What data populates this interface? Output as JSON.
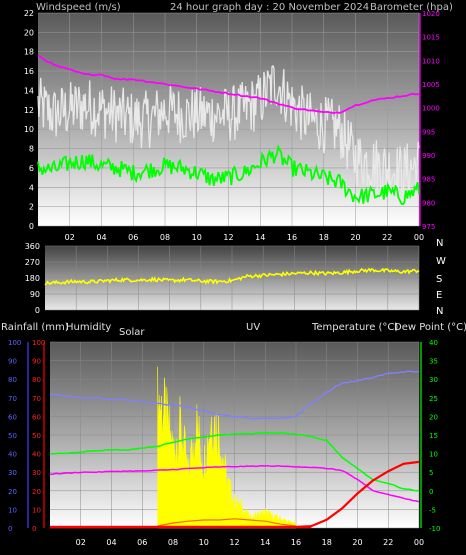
{
  "header": {
    "left": "Windspeed (m/s)",
    "center": "24 hour graph day : 20 November 2024",
    "right": "Barometer (hpa)"
  },
  "middle_labels": {
    "rainfall": "Rainfall (mm)",
    "humidity": "Humidity",
    "solar": "Solar",
    "uv": "UV",
    "temperature": "Temperature (°C)",
    "dewpoint": "Dew Point (°C)"
  },
  "colors": {
    "wind_gust": "#e8e8e8",
    "wind_avg": "#00ff00",
    "barometer": "#ff00ff",
    "direction": "#ffff00",
    "humidity": "#8080ff",
    "temperature": "#00ff00",
    "dewpoint": "#ff00ff",
    "rain": "#ff0000",
    "solar": "#ffff00",
    "uv": "#ff6600"
  },
  "chart_data": [
    {
      "type": "line",
      "name": "wind_and_barometer",
      "x_ticks": [
        "02",
        "04",
        "06",
        "08",
        "10",
        "12",
        "14",
        "16",
        "18",
        "20",
        "22",
        "00"
      ],
      "ylim_left": [
        0,
        22
      ],
      "y_ticks_left": [
        "0",
        "2",
        "4",
        "6",
        "8",
        "10",
        "12",
        "14",
        "16",
        "18",
        "20",
        "22"
      ],
      "ylim_right": [
        975,
        1020
      ],
      "y_ticks_right": [
        "975",
        "980",
        "985",
        "990",
        "995",
        "1000",
        "1005",
        "1010",
        "1015",
        "1020"
      ],
      "series": [
        {
          "x": [
            0,
            1,
            2,
            3,
            4,
            5,
            6,
            7,
            8,
            9,
            10,
            11,
            12,
            13,
            14,
            15,
            16,
            17,
            18,
            19,
            20,
            21,
            22,
            23,
            24
          ],
          "values": [
            12.5,
            11.5,
            12.0,
            12.5,
            12.0,
            11.5,
            11.0,
            11.0,
            12.0,
            11.5,
            11.5,
            11.5,
            11.5,
            12.0,
            13.0,
            15.0,
            12.5,
            11.0,
            10.5,
            10.0,
            7.0,
            6.5,
            6.0,
            5.5,
            6.5
          ]
        },
        {
          "x": [
            0,
            1,
            2,
            3,
            4,
            5,
            6,
            7,
            8,
            9,
            10,
            11,
            12,
            13,
            14,
            15,
            16,
            17,
            18,
            19,
            20,
            21,
            22,
            23,
            24
          ],
          "values": [
            6.0,
            5.8,
            6.5,
            6.8,
            6.2,
            6.0,
            5.5,
            5.8,
            6.2,
            6.0,
            5.5,
            4.8,
            5.0,
            5.5,
            6.5,
            7.5,
            6.0,
            5.5,
            5.0,
            4.5,
            3.0,
            3.2,
            3.5,
            3.0,
            3.8
          ]
        },
        {
          "x": [
            0,
            1,
            2,
            3,
            4,
            5,
            6,
            7,
            8,
            9,
            10,
            11,
            12,
            13,
            14,
            15,
            16,
            17,
            18,
            19,
            20,
            21,
            22,
            23,
            24
          ],
          "values": [
            1011,
            1009,
            1008,
            1007,
            1007,
            1006,
            1006,
            1005.5,
            1005,
            1004.5,
            1004,
            1003.5,
            1003,
            1002.5,
            1002,
            1001,
            1000,
            999.5,
            999,
            999,
            1000.5,
            1001.5,
            1002,
            1002.5,
            1003
          ]
        }
      ]
    },
    {
      "type": "line",
      "name": "wind_direction",
      "x_ticks": [
        "02",
        "04",
        "06",
        "08",
        "10",
        "12",
        "14",
        "16",
        "18",
        "20",
        "22",
        "00"
      ],
      "ylim": [
        0,
        360
      ],
      "y_ticks": [
        "0",
        "90",
        "180",
        "270",
        "360"
      ],
      "side_labels": [
        "N",
        "W",
        "S",
        "E",
        "N"
      ],
      "series": [
        {
          "x": [
            0,
            1,
            2,
            3,
            4,
            5,
            6,
            7,
            8,
            9,
            10,
            11,
            12,
            13,
            14,
            15,
            16,
            17,
            18,
            19,
            20,
            21,
            22,
            23,
            24
          ],
          "values": [
            150,
            155,
            160,
            158,
            165,
            170,
            168,
            172,
            165,
            170,
            162,
            160,
            165,
            190,
            195,
            200,
            205,
            210,
            205,
            210,
            220,
            225,
            220,
            215,
            222
          ]
        }
      ]
    },
    {
      "type": "line",
      "name": "humidity_temperature_rain_solar",
      "x_ticks": [
        "02",
        "04",
        "06",
        "08",
        "10",
        "12",
        "14",
        "16",
        "18",
        "20",
        "22",
        "00"
      ],
      "ylim_humidity": [
        0,
        100
      ],
      "y_ticks_humidity": [
        "0",
        "10",
        "20",
        "30",
        "40",
        "50",
        "60",
        "70",
        "80",
        "90",
        "100"
      ],
      "ylim_rain": [
        0,
        100
      ],
      "y_ticks_rain": [
        "0",
        "10",
        "20",
        "30",
        "40",
        "50",
        "60",
        "70",
        "80",
        "90",
        "100"
      ],
      "ylim_temperature": [
        -10,
        40
      ],
      "y_ticks_temperature": [
        "-10",
        "-5",
        "0",
        "5",
        "10",
        "15",
        "20",
        "25",
        "30",
        "35",
        "40"
      ],
      "series": [
        {
          "x": [
            0,
            1,
            2,
            3,
            4,
            5,
            6,
            7,
            8,
            9,
            10,
            11,
            12,
            13,
            14,
            15,
            16,
            17,
            18,
            19,
            20,
            21,
            22,
            23,
            24
          ],
          "values": [
            72,
            71,
            70,
            70,
            69,
            69,
            68,
            67,
            66,
            65,
            63,
            61,
            60,
            59,
            59,
            59,
            60,
            67,
            73,
            78,
            79,
            81,
            83,
            84,
            84
          ]
        },
        {
          "x": [
            0,
            1,
            2,
            3,
            4,
            5,
            6,
            7,
            8,
            9,
            10,
            11,
            12,
            13,
            14,
            15,
            16,
            17,
            18,
            19,
            20,
            21,
            22,
            23,
            24
          ],
          "values": [
            10.0,
            10.0,
            10.5,
            10.8,
            11.0,
            11.0,
            11.5,
            12.0,
            13.0,
            14.0,
            14.5,
            15.0,
            15.2,
            15.4,
            15.5,
            15.5,
            15.2,
            14.5,
            13.5,
            9.0,
            6.0,
            3.0,
            2.0,
            0.5,
            0.0
          ]
        },
        {
          "x": [
            0,
            1,
            2,
            3,
            4,
            5,
            6,
            7,
            8,
            9,
            10,
            11,
            12,
            13,
            14,
            15,
            16,
            17,
            18,
            19,
            20,
            21,
            22,
            23,
            24
          ],
          "values": [
            4.5,
            4.7,
            5.0,
            5.0,
            5.2,
            5.3,
            5.3,
            5.5,
            5.7,
            6.0,
            6.2,
            6.4,
            6.5,
            6.6,
            6.7,
            6.6,
            6.5,
            6.3,
            6.0,
            5.5,
            3.0,
            0.0,
            -1.0,
            -2.0,
            -3.0
          ]
        },
        {
          "x": [
            0,
            1,
            2,
            3,
            4,
            5,
            6,
            7,
            8,
            9,
            10,
            11,
            12,
            13,
            14,
            15,
            16,
            17,
            18,
            19,
            20,
            21,
            22,
            23,
            24
          ],
          "values": [
            0,
            0,
            0,
            0,
            0,
            0,
            0,
            0,
            0,
            0,
            0,
            0,
            0,
            0,
            0,
            0,
            0,
            0.5,
            4,
            10,
            18,
            25,
            30,
            34,
            35
          ]
        },
        {
          "x": [
            7,
            7.5,
            8,
            8.5,
            9,
            9.5,
            10,
            10.5,
            11,
            11.5,
            12,
            12.5,
            13,
            13.5,
            14,
            14.5,
            15,
            15.5,
            16
          ],
          "values": [
            250,
            210,
            150,
            190,
            100,
            200,
            120,
            210,
            180,
            90,
            50,
            40,
            20,
            25,
            30,
            22,
            18,
            12,
            8
          ]
        },
        {
          "x": [
            7,
            8,
            9,
            10,
            11,
            12,
            13,
            14,
            15,
            16
          ],
          "values": [
            0,
            0.5,
            0.8,
            1.0,
            1.0,
            1.2,
            1.0,
            0.8,
            0.3,
            0
          ]
        }
      ]
    }
  ]
}
